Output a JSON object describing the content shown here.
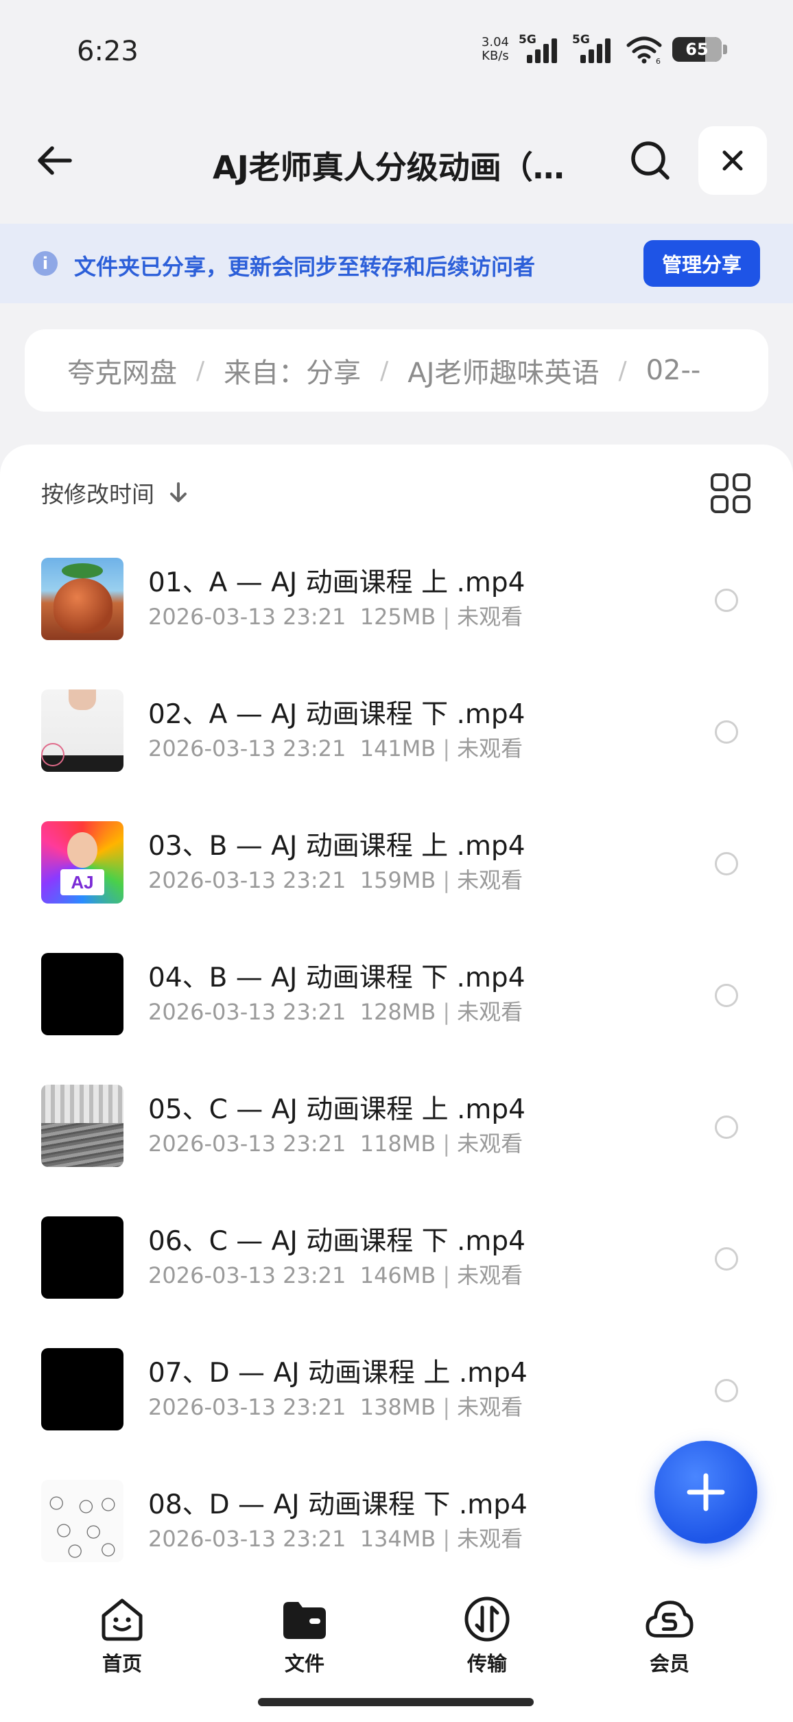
{
  "status_bar": {
    "time": "6:23",
    "net_speed_value": "3.04",
    "net_speed_unit": "KB/s",
    "sim1_label": "5G",
    "sim2_label": "5G",
    "wifi_label": "6",
    "battery": "65"
  },
  "header": {
    "title": "AJ老师真人分级动画（…",
    "back_icon": "arrow-left-icon",
    "search_icon": "search-icon",
    "close_icon": "close-icon"
  },
  "share_banner": {
    "text": "文件夹已分享，更新会同步至转存和后续访问者",
    "button_label": "管理分享",
    "accent_color": "#1e54e6"
  },
  "breadcrumb": {
    "items": [
      "夸克网盘",
      "来自：分享",
      "AJ老师趣味英语",
      "02--"
    ],
    "separator": "/"
  },
  "list": {
    "sort_label": "按修改时间",
    "files": [
      {
        "name": "01、A — AJ 动画课程 上 .mp4",
        "date": "2026-03-13 23:21",
        "size": "125MB",
        "status": "未观看"
      },
      {
        "name": "02、A — AJ 动画课程 下 .mp4",
        "date": "2026-03-13 23:21",
        "size": "141MB",
        "status": "未观看"
      },
      {
        "name": "03、B — AJ 动画课程 上 .mp4",
        "date": "2026-03-13 23:21",
        "size": "159MB",
        "status": "未观看"
      },
      {
        "name": "04、B — AJ 动画课程 下 .mp4",
        "date": "2026-03-13 23:21",
        "size": "128MB",
        "status": "未观看"
      },
      {
        "name": "05、C — AJ 动画课程 上 .mp4",
        "date": "2026-03-13 23:21",
        "size": "118MB",
        "status": "未观看"
      },
      {
        "name": "06、C — AJ 动画课程 下 .mp4",
        "date": "2026-03-13 23:21",
        "size": "146MB",
        "status": "未观看"
      },
      {
        "name": "07、D — AJ 动画课程 上 .mp4",
        "date": "2026-03-13 23:21",
        "size": "138MB",
        "status": "未观看"
      },
      {
        "name": "08、D — AJ 动画课程 下 .mp4",
        "date": "2026-03-13 23:21",
        "size": "134MB",
        "status": "未观看"
      }
    ],
    "thumb_text_03": "AJ"
  },
  "bottom_nav": {
    "items": [
      {
        "label": "首页",
        "icon": "home-face-icon"
      },
      {
        "label": "文件",
        "icon": "folder-icon"
      },
      {
        "label": "传输",
        "icon": "transfer-icon"
      },
      {
        "label": "会员",
        "icon": "member-cloud-icon"
      }
    ],
    "active_index": 1
  }
}
